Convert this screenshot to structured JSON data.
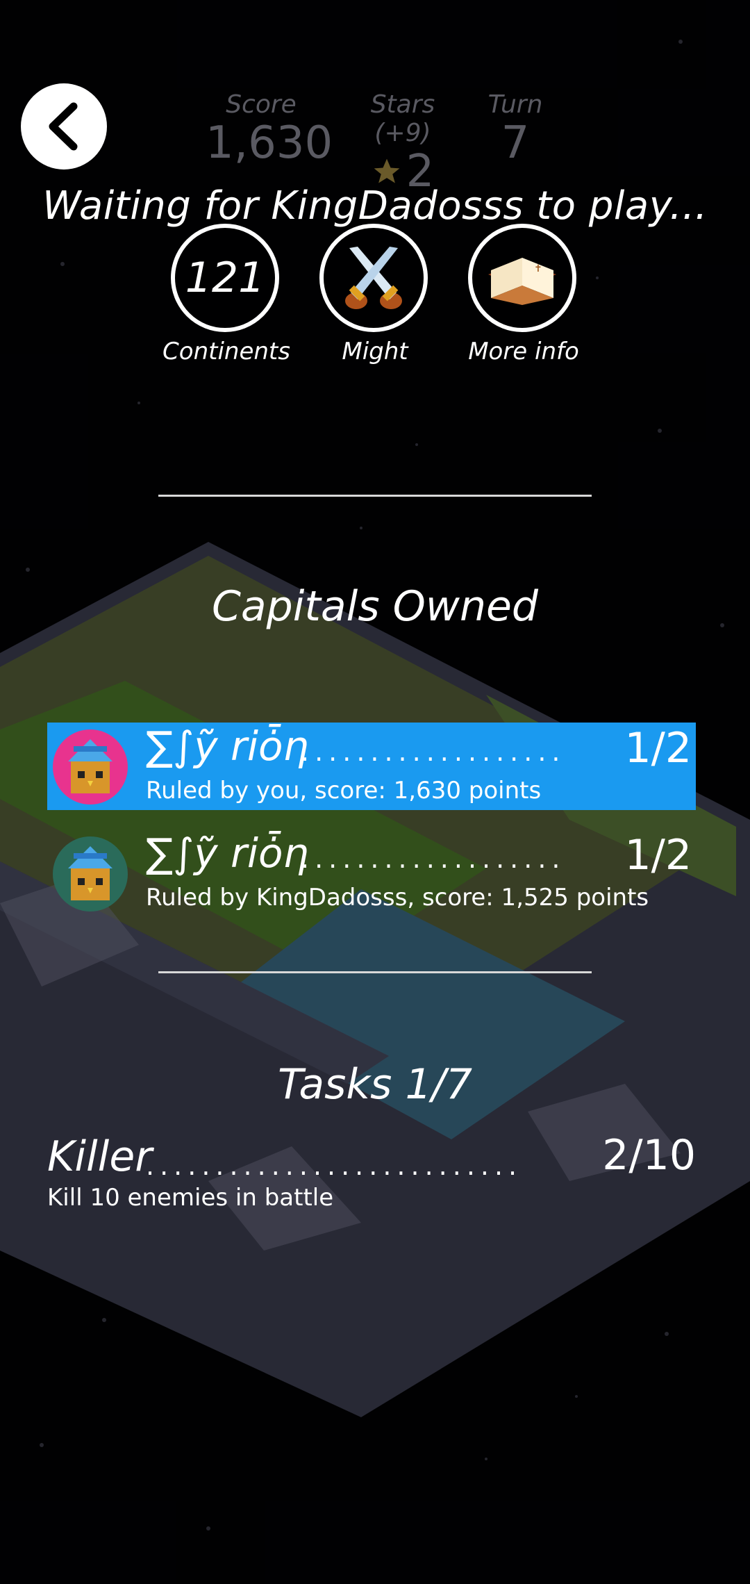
{
  "header": {
    "stats": [
      {
        "label": "Score",
        "value": "1,630"
      },
      {
        "label": "Stars (+9)",
        "value": "2"
      },
      {
        "label": "Turn",
        "value": "7"
      }
    ],
    "waiting_text": "Waiting for KingDadosss to play..."
  },
  "actions": {
    "continents_value": "121",
    "continents_label": "Continents",
    "might_label": "Might",
    "more_info_label": "More info"
  },
  "capitals": {
    "title": "Capitals Owned",
    "rows": [
      {
        "name": "∑∫ỹ riȱη",
        "dots": "...................",
        "count": "1/2",
        "sub": "Ruled by you, score: 1,630 points"
      },
      {
        "name": "∑∫ỹ riȱη",
        "dots": "...................",
        "count": "1/2",
        "sub": "Ruled by KingDadosss, score: 1,525 points"
      }
    ]
  },
  "tasks": {
    "title": "Tasks 1/7",
    "items": [
      {
        "name": "Killer",
        "dots": "...........................",
        "count": "2/10",
        "description": "Kill 10 enemies in battle"
      }
    ]
  },
  "colors": {
    "highlight": "#1a9af0",
    "player_avatar": "#e8338e",
    "enemy_avatar": "#2a6b5a"
  }
}
